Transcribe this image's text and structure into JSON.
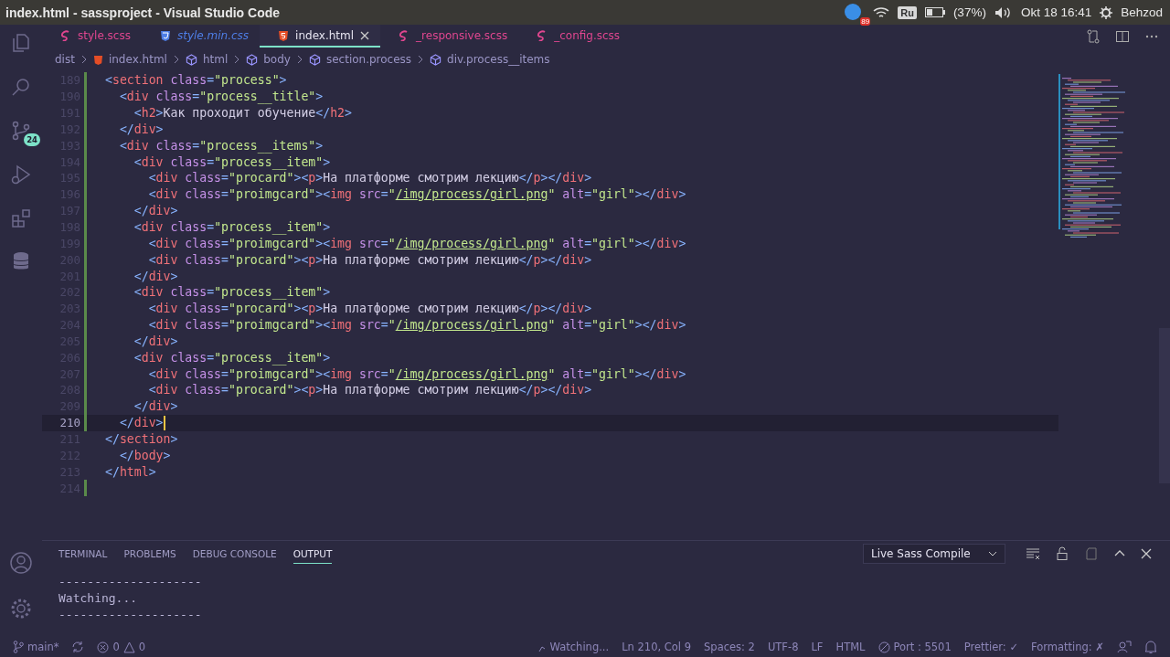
{
  "top_panel": {
    "window_title": "index.html - sassproject - Visual Studio Code",
    "notification_count": "89",
    "keyboard_layout": "Ru",
    "battery": "(37%)",
    "clock": "Okt 18 16:41",
    "user": "Behzod"
  },
  "activity_bar": {
    "source_control_badge": "24"
  },
  "tabs": [
    {
      "label": "style.scss",
      "kind": "sass",
      "selected": false,
      "preview": false
    },
    {
      "label": "style.min.css",
      "kind": "css",
      "selected": false,
      "preview": true
    },
    {
      "label": "index.html",
      "kind": "html",
      "selected": true,
      "preview": false
    },
    {
      "label": "_responsive.scss",
      "kind": "sass",
      "selected": false,
      "preview": false
    },
    {
      "label": "_config.scss",
      "kind": "sass",
      "selected": false,
      "preview": false
    }
  ],
  "breadcrumb": [
    {
      "label": "dist",
      "kind": "folder"
    },
    {
      "label": "index.html",
      "kind": "html"
    },
    {
      "label": "html",
      "kind": "element"
    },
    {
      "label": "body",
      "kind": "element"
    },
    {
      "label": "section.process",
      "kind": "element"
    },
    {
      "label": "div.process__items",
      "kind": "element"
    }
  ],
  "editor": {
    "lines": [
      {
        "num": "189",
        "current": false,
        "changed": true,
        "tokens": [
          {
            "kind": "punct",
            "text": "<"
          },
          {
            "kind": "tag",
            "text": "section"
          },
          {
            "kind": "attr",
            "text": " class"
          },
          {
            "kind": "punct",
            "text": "="
          },
          {
            "kind": "string",
            "text": "\"process\""
          },
          {
            "kind": "punct",
            "text": ">"
          }
        ]
      },
      {
        "num": "190",
        "current": false,
        "changed": true,
        "tokens": [
          {
            "kind": "punct",
            "text": "  <"
          },
          {
            "kind": "tag",
            "text": "div"
          },
          {
            "kind": "attr",
            "text": " class"
          },
          {
            "kind": "punct",
            "text": "="
          },
          {
            "kind": "string",
            "text": "\"process__title\""
          },
          {
            "kind": "punct",
            "text": ">"
          }
        ]
      },
      {
        "num": "191",
        "current": false,
        "changed": true,
        "tokens": [
          {
            "kind": "punct",
            "text": "    <"
          },
          {
            "kind": "tag",
            "text": "h2"
          },
          {
            "kind": "punct",
            "text": ">"
          },
          {
            "kind": "text",
            "text": "Как проходит обучение"
          },
          {
            "kind": "punct",
            "text": "</"
          },
          {
            "kind": "tag",
            "text": "h2"
          },
          {
            "kind": "punct",
            "text": ">"
          }
        ]
      },
      {
        "num": "192",
        "current": false,
        "changed": true,
        "tokens": [
          {
            "kind": "punct",
            "text": "  </"
          },
          {
            "kind": "tag",
            "text": "div"
          },
          {
            "kind": "punct",
            "text": ">"
          }
        ]
      },
      {
        "num": "193",
        "current": false,
        "changed": true,
        "tokens": [
          {
            "kind": "punct",
            "text": "  <"
          },
          {
            "kind": "tag",
            "text": "div"
          },
          {
            "kind": "attr",
            "text": " class"
          },
          {
            "kind": "punct",
            "text": "="
          },
          {
            "kind": "string",
            "text": "\"process__items\""
          },
          {
            "kind": "punct",
            "text": ">"
          }
        ]
      },
      {
        "num": "194",
        "current": false,
        "changed": true,
        "tokens": [
          {
            "kind": "punct",
            "text": "    <"
          },
          {
            "kind": "tag",
            "text": "div"
          },
          {
            "kind": "attr",
            "text": " class"
          },
          {
            "kind": "punct",
            "text": "="
          },
          {
            "kind": "string",
            "text": "\"process__item\""
          },
          {
            "kind": "punct",
            "text": ">"
          }
        ]
      },
      {
        "num": "195",
        "current": false,
        "changed": true,
        "tokens": [
          {
            "kind": "punct",
            "text": "      <"
          },
          {
            "kind": "tag",
            "text": "div"
          },
          {
            "kind": "attr",
            "text": " class"
          },
          {
            "kind": "punct",
            "text": "="
          },
          {
            "kind": "string",
            "text": "\"procard\""
          },
          {
            "kind": "punct",
            "text": "><"
          },
          {
            "kind": "tag",
            "text": "p"
          },
          {
            "kind": "punct",
            "text": ">"
          },
          {
            "kind": "text",
            "text": "На платформе смотрим лекцию"
          },
          {
            "kind": "punct",
            "text": "</"
          },
          {
            "kind": "tag",
            "text": "p"
          },
          {
            "kind": "punct",
            "text": "></"
          },
          {
            "kind": "tag",
            "text": "div"
          },
          {
            "kind": "punct",
            "text": ">"
          }
        ]
      },
      {
        "num": "196",
        "current": false,
        "changed": true,
        "tokens": [
          {
            "kind": "punct",
            "text": "      <"
          },
          {
            "kind": "tag",
            "text": "div"
          },
          {
            "kind": "attr",
            "text": " class"
          },
          {
            "kind": "punct",
            "text": "="
          },
          {
            "kind": "string",
            "text": "\"proimgcard\""
          },
          {
            "kind": "punct",
            "text": "><"
          },
          {
            "kind": "tag",
            "text": "img"
          },
          {
            "kind": "attr",
            "text": " src"
          },
          {
            "kind": "punct",
            "text": "="
          },
          {
            "kind": "string",
            "text": "\""
          },
          {
            "kind": "link",
            "text": "/img/process/girl.png"
          },
          {
            "kind": "string",
            "text": "\""
          },
          {
            "kind": "attr",
            "text": " alt"
          },
          {
            "kind": "punct",
            "text": "="
          },
          {
            "kind": "string",
            "text": "\"girl\""
          },
          {
            "kind": "punct",
            "text": "></"
          },
          {
            "kind": "tag",
            "text": "div"
          },
          {
            "kind": "punct",
            "text": ">"
          }
        ]
      },
      {
        "num": "197",
        "current": false,
        "changed": true,
        "tokens": [
          {
            "kind": "punct",
            "text": "    </"
          },
          {
            "kind": "tag",
            "text": "div"
          },
          {
            "kind": "punct",
            "text": ">"
          }
        ]
      },
      {
        "num": "198",
        "current": false,
        "changed": true,
        "tokens": [
          {
            "kind": "punct",
            "text": "    <"
          },
          {
            "kind": "tag",
            "text": "div"
          },
          {
            "kind": "attr",
            "text": " class"
          },
          {
            "kind": "punct",
            "text": "="
          },
          {
            "kind": "string",
            "text": "\"process__item\""
          },
          {
            "kind": "punct",
            "text": ">"
          }
        ]
      },
      {
        "num": "199",
        "current": false,
        "changed": true,
        "tokens": [
          {
            "kind": "punct",
            "text": "      <"
          },
          {
            "kind": "tag",
            "text": "div"
          },
          {
            "kind": "attr",
            "text": " class"
          },
          {
            "kind": "punct",
            "text": "="
          },
          {
            "kind": "string",
            "text": "\"proimgcard\""
          },
          {
            "kind": "punct",
            "text": "><"
          },
          {
            "kind": "tag",
            "text": "img"
          },
          {
            "kind": "attr",
            "text": " src"
          },
          {
            "kind": "punct",
            "text": "="
          },
          {
            "kind": "string",
            "text": "\""
          },
          {
            "kind": "link",
            "text": "/img/process/girl.png"
          },
          {
            "kind": "string",
            "text": "\""
          },
          {
            "kind": "attr",
            "text": " alt"
          },
          {
            "kind": "punct",
            "text": "="
          },
          {
            "kind": "string",
            "text": "\"girl\""
          },
          {
            "kind": "punct",
            "text": "></"
          },
          {
            "kind": "tag",
            "text": "div"
          },
          {
            "kind": "punct",
            "text": ">"
          }
        ]
      },
      {
        "num": "200",
        "current": false,
        "changed": true,
        "tokens": [
          {
            "kind": "punct",
            "text": "      <"
          },
          {
            "kind": "tag",
            "text": "div"
          },
          {
            "kind": "attr",
            "text": " class"
          },
          {
            "kind": "punct",
            "text": "="
          },
          {
            "kind": "string",
            "text": "\"procard\""
          },
          {
            "kind": "punct",
            "text": "><"
          },
          {
            "kind": "tag",
            "text": "p"
          },
          {
            "kind": "punct",
            "text": ">"
          },
          {
            "kind": "text",
            "text": "На платформе смотрим лекцию"
          },
          {
            "kind": "punct",
            "text": "</"
          },
          {
            "kind": "tag",
            "text": "p"
          },
          {
            "kind": "punct",
            "text": "></"
          },
          {
            "kind": "tag",
            "text": "div"
          },
          {
            "kind": "punct",
            "text": ">"
          }
        ]
      },
      {
        "num": "201",
        "current": false,
        "changed": true,
        "tokens": [
          {
            "kind": "punct",
            "text": "    </"
          },
          {
            "kind": "tag",
            "text": "div"
          },
          {
            "kind": "punct",
            "text": ">"
          }
        ]
      },
      {
        "num": "202",
        "current": false,
        "changed": true,
        "tokens": [
          {
            "kind": "punct",
            "text": "    <"
          },
          {
            "kind": "tag",
            "text": "div"
          },
          {
            "kind": "attr",
            "text": " class"
          },
          {
            "kind": "punct",
            "text": "="
          },
          {
            "kind": "string",
            "text": "\"process__item\""
          },
          {
            "kind": "punct",
            "text": ">"
          }
        ]
      },
      {
        "num": "203",
        "current": false,
        "changed": true,
        "tokens": [
          {
            "kind": "punct",
            "text": "      <"
          },
          {
            "kind": "tag",
            "text": "div"
          },
          {
            "kind": "attr",
            "text": " class"
          },
          {
            "kind": "punct",
            "text": "="
          },
          {
            "kind": "string",
            "text": "\"procard\""
          },
          {
            "kind": "punct",
            "text": "><"
          },
          {
            "kind": "tag",
            "text": "p"
          },
          {
            "kind": "punct",
            "text": ">"
          },
          {
            "kind": "text",
            "text": "На платформе смотрим лекцию"
          },
          {
            "kind": "punct",
            "text": "</"
          },
          {
            "kind": "tag",
            "text": "p"
          },
          {
            "kind": "punct",
            "text": "></"
          },
          {
            "kind": "tag",
            "text": "div"
          },
          {
            "kind": "punct",
            "text": ">"
          }
        ]
      },
      {
        "num": "204",
        "current": false,
        "changed": true,
        "tokens": [
          {
            "kind": "punct",
            "text": "      <"
          },
          {
            "kind": "tag",
            "text": "div"
          },
          {
            "kind": "attr",
            "text": " class"
          },
          {
            "kind": "punct",
            "text": "="
          },
          {
            "kind": "string",
            "text": "\"proimgcard\""
          },
          {
            "kind": "punct",
            "text": "><"
          },
          {
            "kind": "tag",
            "text": "img"
          },
          {
            "kind": "attr",
            "text": " src"
          },
          {
            "kind": "punct",
            "text": "="
          },
          {
            "kind": "string",
            "text": "\""
          },
          {
            "kind": "link",
            "text": "/img/process/girl.png"
          },
          {
            "kind": "string",
            "text": "\""
          },
          {
            "kind": "attr",
            "text": " alt"
          },
          {
            "kind": "punct",
            "text": "="
          },
          {
            "kind": "string",
            "text": "\"girl\""
          },
          {
            "kind": "punct",
            "text": "></"
          },
          {
            "kind": "tag",
            "text": "div"
          },
          {
            "kind": "punct",
            "text": ">"
          }
        ]
      },
      {
        "num": "205",
        "current": false,
        "changed": true,
        "tokens": [
          {
            "kind": "punct",
            "text": "    </"
          },
          {
            "kind": "tag",
            "text": "div"
          },
          {
            "kind": "punct",
            "text": ">"
          }
        ]
      },
      {
        "num": "206",
        "current": false,
        "changed": true,
        "tokens": [
          {
            "kind": "punct",
            "text": "    <"
          },
          {
            "kind": "tag",
            "text": "div"
          },
          {
            "kind": "attr",
            "text": " class"
          },
          {
            "kind": "punct",
            "text": "="
          },
          {
            "kind": "string",
            "text": "\"process__item\""
          },
          {
            "kind": "punct",
            "text": ">"
          }
        ]
      },
      {
        "num": "207",
        "current": false,
        "changed": true,
        "tokens": [
          {
            "kind": "punct",
            "text": "      <"
          },
          {
            "kind": "tag",
            "text": "div"
          },
          {
            "kind": "attr",
            "text": " class"
          },
          {
            "kind": "punct",
            "text": "="
          },
          {
            "kind": "string",
            "text": "\"proimgcard\""
          },
          {
            "kind": "punct",
            "text": "><"
          },
          {
            "kind": "tag",
            "text": "img"
          },
          {
            "kind": "attr",
            "text": " src"
          },
          {
            "kind": "punct",
            "text": "="
          },
          {
            "kind": "string",
            "text": "\""
          },
          {
            "kind": "link",
            "text": "/img/process/girl.png"
          },
          {
            "kind": "string",
            "text": "\""
          },
          {
            "kind": "attr",
            "text": " alt"
          },
          {
            "kind": "punct",
            "text": "="
          },
          {
            "kind": "string",
            "text": "\"girl\""
          },
          {
            "kind": "punct",
            "text": "></"
          },
          {
            "kind": "tag",
            "text": "div"
          },
          {
            "kind": "punct",
            "text": ">"
          }
        ]
      },
      {
        "num": "208",
        "current": false,
        "changed": true,
        "tokens": [
          {
            "kind": "punct",
            "text": "      <"
          },
          {
            "kind": "tag",
            "text": "div"
          },
          {
            "kind": "attr",
            "text": " class"
          },
          {
            "kind": "punct",
            "text": "="
          },
          {
            "kind": "string",
            "text": "\"procard\""
          },
          {
            "kind": "punct",
            "text": "><"
          },
          {
            "kind": "tag",
            "text": "p"
          },
          {
            "kind": "punct",
            "text": ">"
          },
          {
            "kind": "text",
            "text": "На платформе смотрим лекцию"
          },
          {
            "kind": "punct",
            "text": "</"
          },
          {
            "kind": "tag",
            "text": "p"
          },
          {
            "kind": "punct",
            "text": "></"
          },
          {
            "kind": "tag",
            "text": "div"
          },
          {
            "kind": "punct",
            "text": ">"
          }
        ]
      },
      {
        "num": "209",
        "current": false,
        "changed": true,
        "tokens": [
          {
            "kind": "punct",
            "text": "    </"
          },
          {
            "kind": "tag",
            "text": "div"
          },
          {
            "kind": "punct",
            "text": ">"
          }
        ]
      },
      {
        "num": "210",
        "current": true,
        "changed": true,
        "tokens": [
          {
            "kind": "punct",
            "text": "  </"
          },
          {
            "kind": "tag",
            "text": "div"
          },
          {
            "kind": "punct",
            "text": ">"
          }
        ]
      },
      {
        "num": "211",
        "current": false,
        "changed": false,
        "tokens": [
          {
            "kind": "punct",
            "text": "</"
          },
          {
            "kind": "tag",
            "text": "section"
          },
          {
            "kind": "punct",
            "text": ">"
          }
        ]
      },
      {
        "num": "212",
        "current": false,
        "changed": false,
        "tokens": [
          {
            "kind": "punct",
            "text": "  </"
          },
          {
            "kind": "tag",
            "text": "body"
          },
          {
            "kind": "punct",
            "text": ">"
          }
        ]
      },
      {
        "num": "213",
        "current": false,
        "changed": false,
        "tokens": [
          {
            "kind": "punct",
            "text": "</"
          },
          {
            "kind": "tag",
            "text": "html"
          },
          {
            "kind": "punct",
            "text": ">"
          }
        ]
      },
      {
        "num": "214",
        "current": false,
        "changed": true
      }
    ]
  },
  "panel": {
    "tabs": [
      {
        "label": "TERMINAL",
        "selected": false
      },
      {
        "label": "PROBLEMS",
        "selected": false
      },
      {
        "label": "DEBUG CONSOLE",
        "selected": false
      },
      {
        "label": "OUTPUT",
        "selected": true
      }
    ],
    "output_channel": "Live Sass Compile",
    "output_lines": [
      "--------------------",
      "Watching...",
      "--------------------"
    ]
  },
  "status_bar": {
    "branch": "main*",
    "errors": "0",
    "warnings": "0",
    "right": [
      {
        "label": "Watching...",
        "kind": "spinner"
      },
      {
        "label": "Ln 210, Col 9",
        "kind": "plain"
      },
      {
        "label": "Spaces: 2",
        "kind": "plain"
      },
      {
        "label": "UTF-8",
        "kind": "plain"
      },
      {
        "label": "LF",
        "kind": "plain"
      },
      {
        "label": "HTML",
        "kind": "plain"
      },
      {
        "label": "Port : 5501",
        "kind": "port"
      },
      {
        "label": "Prettier: ✓",
        "kind": "plain"
      },
      {
        "label": "Formatting: ✗",
        "kind": "plain"
      }
    ]
  }
}
